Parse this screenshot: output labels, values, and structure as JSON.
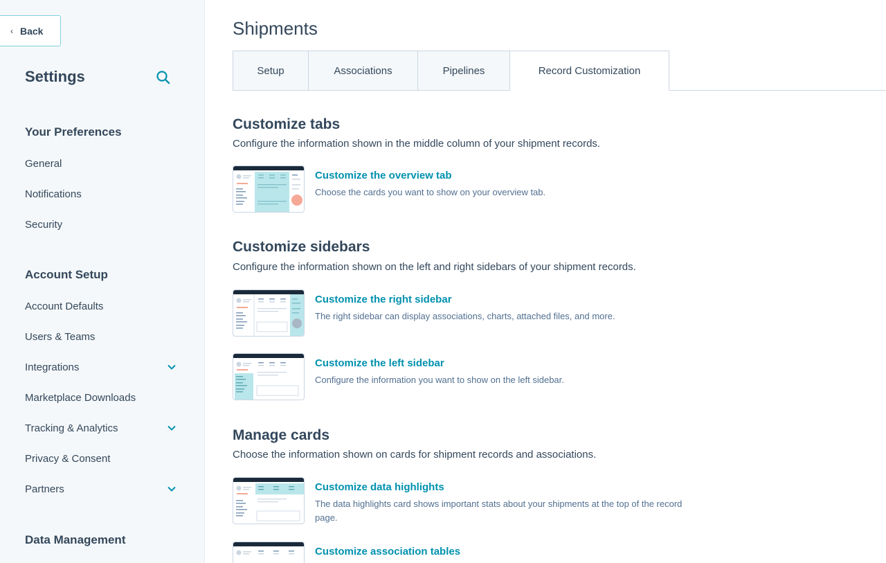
{
  "sidebar": {
    "back_label": "Back",
    "title": "Settings",
    "sections": [
      {
        "heading": "Your Preferences",
        "items": [
          {
            "label": "General"
          },
          {
            "label": "Notifications"
          },
          {
            "label": "Security"
          }
        ]
      },
      {
        "heading": "Account Setup",
        "items": [
          {
            "label": "Account Defaults"
          },
          {
            "label": "Users & Teams"
          },
          {
            "label": "Integrations",
            "expandable": true
          },
          {
            "label": "Marketplace Downloads"
          },
          {
            "label": "Tracking & Analytics",
            "expandable": true
          },
          {
            "label": "Privacy & Consent"
          },
          {
            "label": "Partners",
            "expandable": true
          }
        ]
      },
      {
        "heading": "Data Management",
        "items": []
      }
    ]
  },
  "main": {
    "title": "Shipments",
    "tabs": [
      {
        "label": "Setup"
      },
      {
        "label": "Associations"
      },
      {
        "label": "Pipelines"
      },
      {
        "label": "Record Customization",
        "active": true
      }
    ],
    "sections": [
      {
        "title": "Customize tabs",
        "description": "Configure the information shown in the middle column of your shipment records.",
        "items": [
          {
            "link": "Customize the overview tab",
            "description": "Choose the cards you want to show on your overview tab.",
            "thumb": "overview"
          }
        ]
      },
      {
        "title": "Customize sidebars",
        "description": "Configure the information shown on the left and right sidebars of your shipment records.",
        "items": [
          {
            "link": "Customize the right sidebar",
            "description": "The right sidebar can display associations, charts, attached files, and more.",
            "thumb": "right"
          },
          {
            "link": "Customize the left sidebar",
            "description": "Configure the information you want to show on the left sidebar.",
            "thumb": "left"
          }
        ]
      },
      {
        "title": "Manage cards",
        "description": "Choose the information shown on cards for shipment records and associations.",
        "items": [
          {
            "link": "Customize data highlights",
            "description": "The data highlights card shows important stats about your shipments at the top of the record page.",
            "thumb": "highlights"
          },
          {
            "link": "Customize association tables",
            "description": "",
            "thumb": "assoc"
          }
        ]
      }
    ]
  },
  "colors": {
    "accent": "#0091ae",
    "text": "#33475b",
    "highlight": "#b8e6ea",
    "coral": "#f5a895"
  }
}
